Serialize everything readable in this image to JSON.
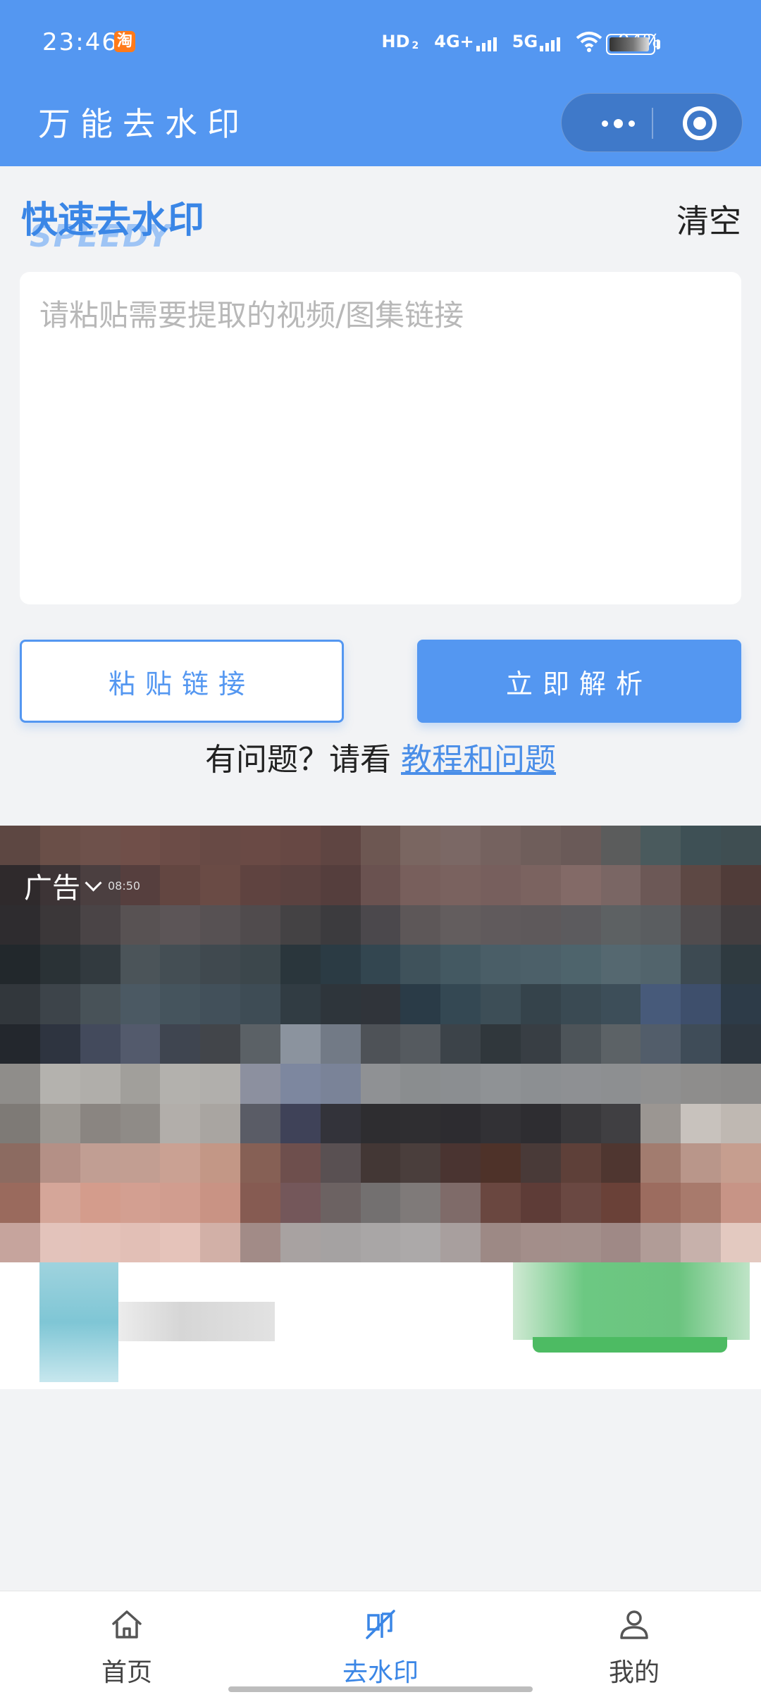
{
  "status_bar": {
    "time": "23:46",
    "app_badge": "淘",
    "network_1": "HD",
    "network_1_sub": "2",
    "network_2": "4G+",
    "network_3": "5G",
    "battery_percent": "94%",
    "battery_level": 0.94
  },
  "header": {
    "title": "万能去水印",
    "capsule_more_icon": "more-dots-icon",
    "capsule_close_icon": "target-circle-icon"
  },
  "main": {
    "section_title": "快速去水印",
    "section_subtitle": "SPEEDY",
    "clear_label": "清空",
    "input_placeholder": "请粘贴需要提取的视频/图集链接",
    "paste_button": "粘贴链接",
    "parse_button": "立即解析",
    "help_prefix": "有问题？请看 ",
    "help_link": "教程和问题"
  },
  "ad": {
    "label": "广告",
    "time_text": "08:50"
  },
  "tabbar": {
    "items": [
      {
        "label": "首页",
        "icon": "home-icon",
        "active": false
      },
      {
        "label": "去水印",
        "icon": "watermark-icon",
        "active": true
      },
      {
        "label": "我的",
        "icon": "user-icon",
        "active": false
      }
    ]
  },
  "colors": {
    "accent": "#5497f1",
    "title_blue": "#3a86e6",
    "background": "#f2f3f5"
  }
}
